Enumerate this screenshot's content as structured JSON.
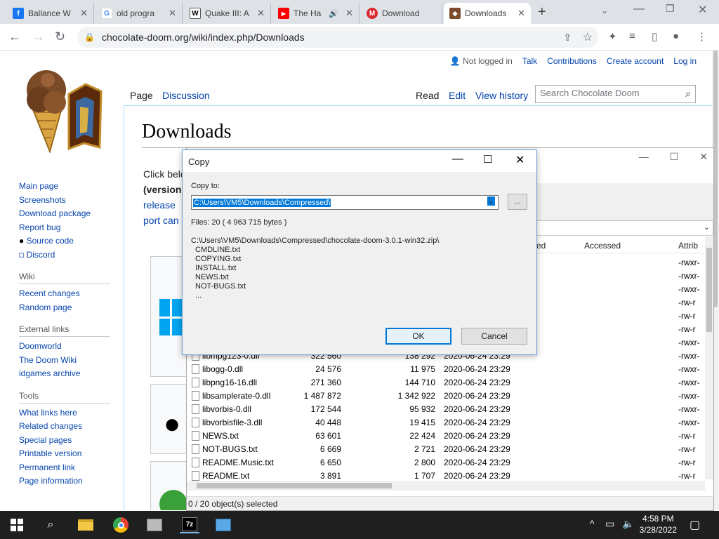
{
  "browser": {
    "tabs": [
      {
        "title": "Ballance W",
        "icon": "facebook-icon",
        "color": "#1877f2",
        "glyph": "f"
      },
      {
        "title": "old progra",
        "icon": "google-icon",
        "color": "#ffffff",
        "glyph": "G"
      },
      {
        "title": "Quake III: A",
        "icon": "wikipedia-icon",
        "color": "#ffffff",
        "glyph": "W"
      },
      {
        "title": "The Ha",
        "icon": "youtube-icon",
        "color": "#ff0000",
        "glyph": "▶"
      },
      {
        "title": "Download",
        "icon": "mega-icon",
        "color": "#d9272e",
        "glyph": "M"
      },
      {
        "title": "Downloads",
        "icon": "chocolate-doom-icon",
        "color": "#7a4a2a",
        "glyph": "🍦",
        "active": true
      }
    ],
    "url": "chocolate-doom.org/wiki/index.php/Downloads"
  },
  "wiki": {
    "personal": {
      "status": "Not logged in",
      "links": [
        "Talk",
        "Contributions",
        "Create account",
        "Log in"
      ]
    },
    "tabs_left": [
      "Page",
      "Discussion"
    ],
    "tabs_right": [
      "Read",
      "Edit",
      "View history"
    ],
    "search_placeholder": "Search Chocolate Doom",
    "title": "Downloads",
    "body_lines": [
      "Click belo",
      "(version",
      "release",
      "port can"
    ],
    "sidebar": {
      "main": [
        "Main page",
        "Screenshots",
        "Download package",
        "Report bug",
        "Source code",
        "Discord"
      ],
      "wiki_heading": "Wiki",
      "wiki": [
        "Recent changes",
        "Random page"
      ],
      "external_heading": "External links",
      "external": [
        "Doomworld",
        "The Doom Wiki",
        "idgames archive"
      ],
      "tools_heading": "Tools",
      "tools": [
        "What links here",
        "Related changes",
        "Special pages",
        "Printable version",
        "Permanent link",
        "Page information"
      ]
    }
  },
  "zip": {
    "col_modified_partial": "ed",
    "col_accessed": "Accessed",
    "col_attrib": "Attrib",
    "attr_rows": [
      "-rwxr-",
      "-rwxr-",
      "-rwxr-",
      "-rw-r",
      "-rw-r",
      "-rw-r",
      "-rwxr-"
    ],
    "rows": [
      {
        "name": "libmpg123-0.dll",
        "size": "322 560",
        "packed": "138 292",
        "modified": "2020-06-24 23:29",
        "attrib": "-rwxr-"
      },
      {
        "name": "libogg-0.dll",
        "size": "24 576",
        "packed": "11 975",
        "modified": "2020-06-24 23:29",
        "attrib": "-rwxr-"
      },
      {
        "name": "libpng16-16.dll",
        "size": "271 360",
        "packed": "144 710",
        "modified": "2020-06-24 23:29",
        "attrib": "-rwxr-"
      },
      {
        "name": "libsamplerate-0.dll",
        "size": "1 487 872",
        "packed": "1 342 922",
        "modified": "2020-06-24 23:29",
        "attrib": "-rwxr-"
      },
      {
        "name": "libvorbis-0.dll",
        "size": "172 544",
        "packed": "95 932",
        "modified": "2020-06-24 23:29",
        "attrib": "-rwxr-"
      },
      {
        "name": "libvorbisfile-3.dll",
        "size": "40 448",
        "packed": "19 415",
        "modified": "2020-06-24 23:29",
        "attrib": "-rwxr-"
      },
      {
        "name": "NEWS.txt",
        "size": "63 601",
        "packed": "22 424",
        "modified": "2020-06-24 23:29",
        "attrib": "-rw-r"
      },
      {
        "name": "NOT-BUGS.txt",
        "size": "6 669",
        "packed": "2 721",
        "modified": "2020-06-24 23:29",
        "attrib": "-rw-r"
      },
      {
        "name": "README.Music.txt",
        "size": "6 650",
        "packed": "2 800",
        "modified": "2020-06-24 23:29",
        "attrib": "-rw-r"
      },
      {
        "name": "README.txt",
        "size": "3 891",
        "packed": "1 707",
        "modified": "2020-06-24 23:29",
        "attrib": "-rw-r"
      }
    ],
    "status": "0 / 20 object(s) selected"
  },
  "dialog": {
    "title": "Copy",
    "copy_to_label": "Copy to:",
    "destination": "C:\\Users\\VM5\\Downloads\\Compressed\\",
    "browse_label": "...",
    "files_info": "Files: 20    ( 4 963 715 bytes )",
    "archive_path": "C:\\Users\\VM5\\Downloads\\Compressed\\chocolate-doom-3.0.1-win32.zip\\",
    "files": [
      "CMDLINE.txt",
      "COPYING.txt",
      "INSTALL.txt",
      "NEWS.txt",
      "NOT-BUGS.txt",
      "..."
    ],
    "ok_label": "OK",
    "cancel_label": "Cancel"
  },
  "taskbar": {
    "time": "4:58 PM",
    "date": "3/28/2022",
    "apps": [
      "file-explorer-icon",
      "chrome-icon",
      "app-icon",
      "7zip-icon",
      "control-panel-icon"
    ]
  }
}
